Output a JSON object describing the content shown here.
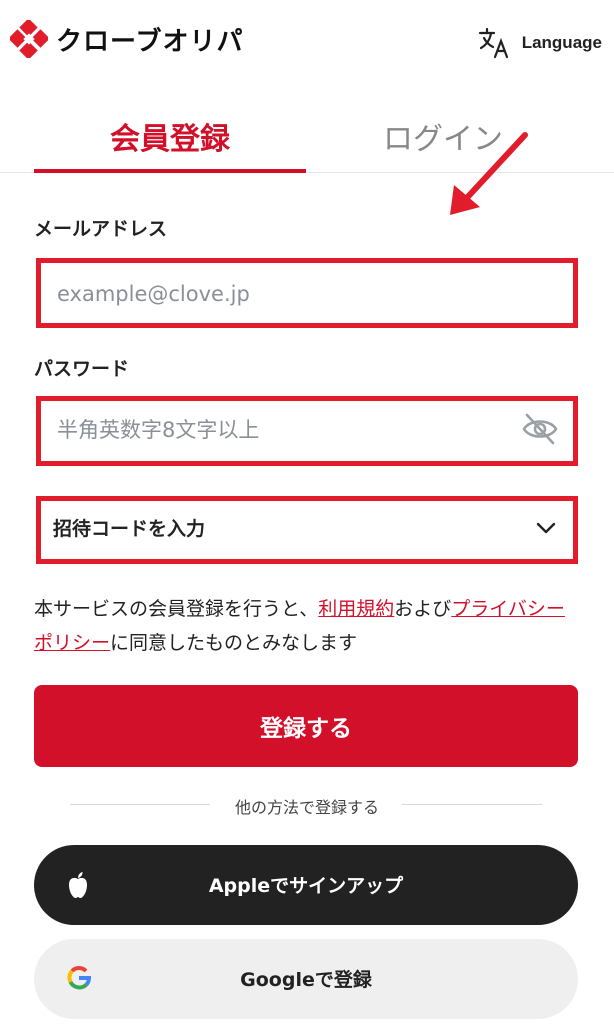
{
  "header": {
    "logo_text": "クローブオリパ",
    "language_label": "Language"
  },
  "tabs": [
    {
      "label": "会員登録",
      "active": true
    },
    {
      "label": "ログイン",
      "active": false
    }
  ],
  "form": {
    "email_label": "メールアドレス",
    "email_placeholder": "example@clove.jp",
    "password_label": "パスワード",
    "password_placeholder": "半角英数字8文字以上",
    "invite_code_label": "招待コードを入力"
  },
  "terms": {
    "prefix": "本サービスの会員登録を行うと、",
    "terms_link": "利用規約",
    "middle": "および",
    "privacy_link": "プライバシーポリシー",
    "suffix": "に同意したものとみなします"
  },
  "register_button": "登録する",
  "other_methods": "他の方法で登録する",
  "apple_button": "Appleでサインアップ",
  "google_button": "Googleで登録",
  "colors": {
    "brand_red": "#d3102a",
    "highlight_red": "#e11d2b",
    "apple_bg": "#222222",
    "google_bg": "#efefef"
  },
  "icons": {
    "logo": "clove-logo-icon",
    "language": "translate-icon",
    "password_toggle": "eye-off-icon",
    "dropdown": "chevron-down-icon",
    "apple": "apple-icon",
    "google": "google-icon",
    "annotation": "red-arrow-icon"
  }
}
